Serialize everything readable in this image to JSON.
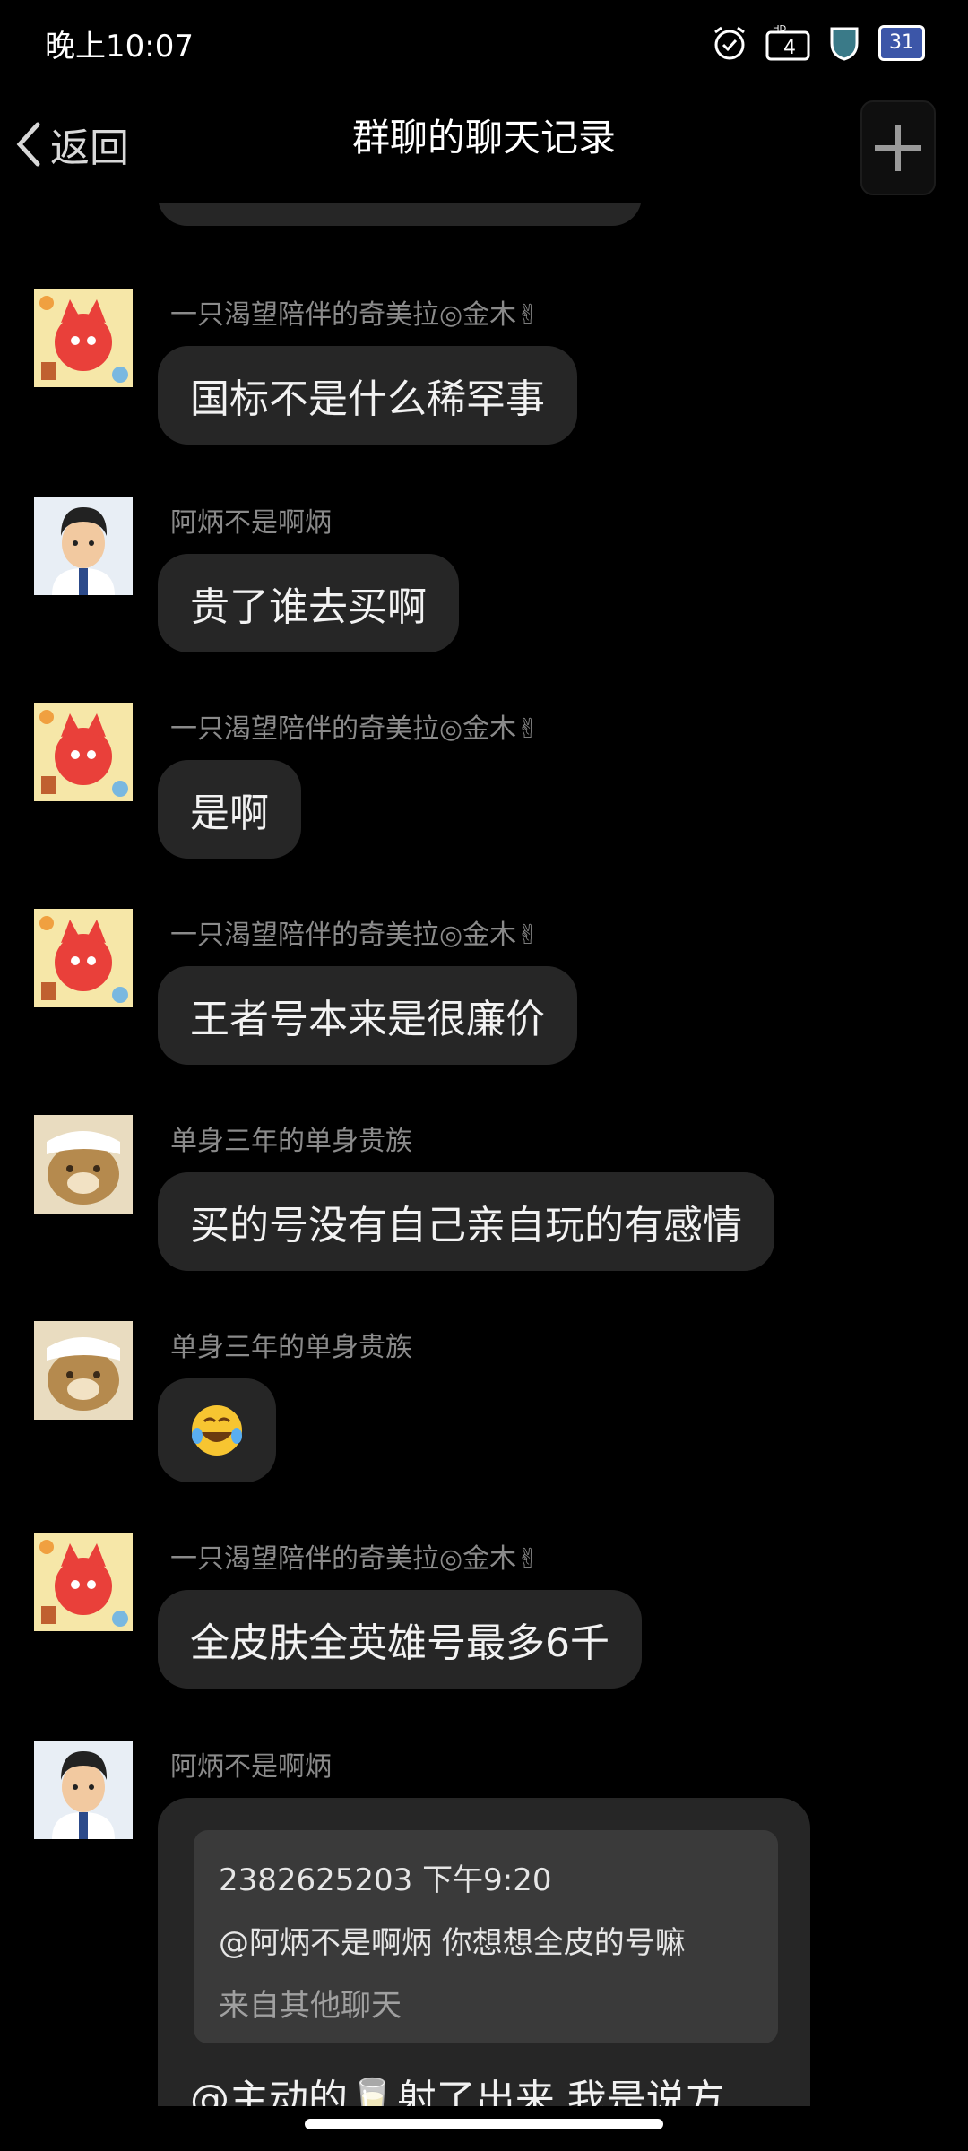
{
  "status_bar": {
    "time": "晚上10:07",
    "icons": [
      "alarm-icon",
      "hd-4g-signal-icon",
      "shield-icon"
    ],
    "battery": "31"
  },
  "header": {
    "back_label": "返回",
    "title": "群聊的聊天记录"
  },
  "messages": [
    {
      "sender": "一只渴望陪伴的奇美拉◎金木✌",
      "text": "国标不是什么稀罕事",
      "avatar": "fox-avatar"
    },
    {
      "sender": "阿炳不是啊炳",
      "text": "贵了谁去买啊",
      "avatar": "man-avatar"
    },
    {
      "sender": "一只渴望陪伴的奇美拉◎金木✌",
      "text": "是啊",
      "avatar": "fox-avatar"
    },
    {
      "sender": "一只渴望陪伴的奇美拉◎金木✌",
      "text": "王者号本来是很廉价",
      "avatar": "fox-avatar"
    },
    {
      "sender": "单身三年的单身贵族",
      "text": "买的号没有自己亲自玩的有感情",
      "avatar": "bear-avatar"
    },
    {
      "sender": "单身三年的单身贵族",
      "text": "😂",
      "avatar": "bear-avatar"
    },
    {
      "sender": "一只渴望陪伴的奇美拉◎金木✌",
      "text": "全皮肤全英雄号最多6千",
      "avatar": "fox-avatar"
    },
    {
      "sender": "阿炳不是啊炳",
      "avatar": "man-avatar",
      "quote": {
        "meta": "2382625203 下午9:20",
        "text": "@阿炳不是啊炳 你想想全皮的号嘛",
        "source": "来自其他聊天"
      },
      "reply": "@主动的🥛射了出来 我是说方"
    }
  ]
}
